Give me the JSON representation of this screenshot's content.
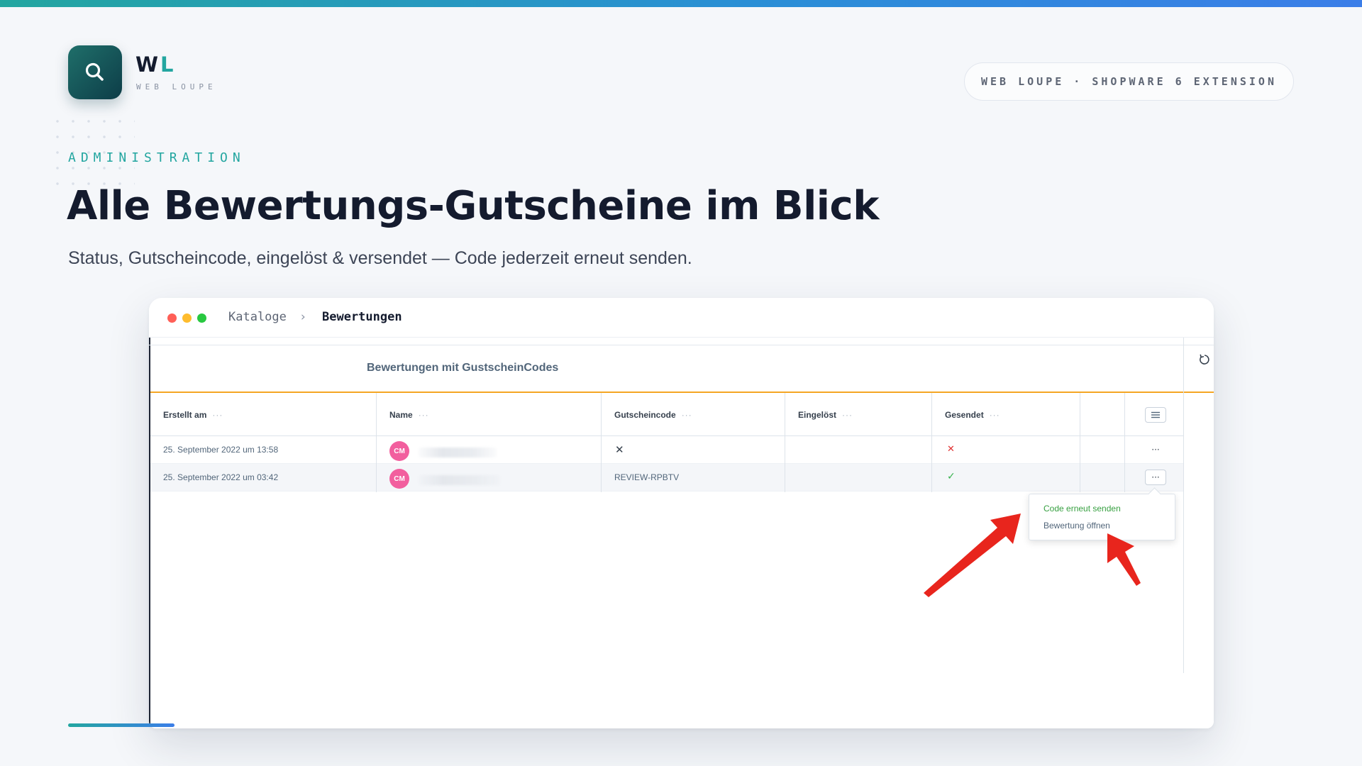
{
  "brand": {
    "mark_primary": "W",
    "mark_accent": "L",
    "subtitle": "WEB LOUPE",
    "pill": "WEB LOUPE · SHOPWARE 6 EXTENSION",
    "logo_icon": "search-icon",
    "accent_color": "#23a6a0"
  },
  "hero": {
    "eyebrow": "ADMINISTRATION",
    "headline": "Alle Bewertungs-Gutscheine im Blick",
    "subline": "Status, Gutscheincode, eingelöst & versendet — Code jederzeit erneut senden."
  },
  "window": {
    "breadcrumb": [
      "Kataloge",
      "Bewertungen"
    ],
    "breadcrumb_separator": "›",
    "card_title": "Bewertungen mit GustscheinCodes",
    "columns": [
      "Erstellt am",
      "Name",
      "Gutscheincode",
      "Eingelöst",
      "Gesendet"
    ],
    "column_menu": "···",
    "rows": [
      {
        "created": "25. September 2022 um 13:58",
        "avatar": "CM",
        "code": "",
        "code_icon": "x-icon",
        "redeemed": "",
        "sent": "no",
        "sent_icon": "x-red-icon",
        "actions": "···"
      },
      {
        "created": "25. September 2022 um 03:42",
        "avatar": "CM",
        "code": "REVIEW-RPBTV",
        "redeemed": "",
        "sent": "yes",
        "sent_icon": "check-icon",
        "actions": "···"
      }
    ],
    "context_menu": [
      "Code erneut senden",
      "Bewertung öffnen"
    ],
    "avatar_color": "#f25f9e",
    "table_accent_color": "#f5a623"
  }
}
